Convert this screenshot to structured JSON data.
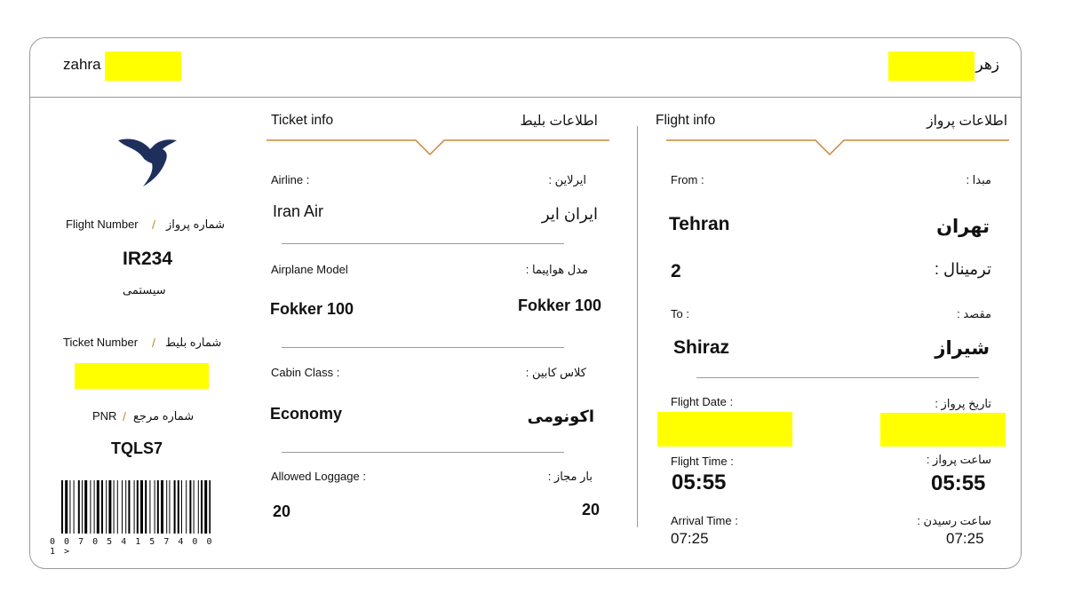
{
  "passenger": {
    "name_en": "zahra",
    "name_fa": "زهرا"
  },
  "stub": {
    "flight_number_label_en": "Flight Number",
    "flight_number_label_fa": "شماره پرواز",
    "separator": "/",
    "flight_number": "IR234",
    "flight_type_fa": "سیستمی",
    "ticket_number_label_en": "Ticket Number",
    "ticket_number_label_fa": "شماره بلیط",
    "pnr_label_en": "PNR",
    "pnr_label_fa": "شماره مرجع",
    "pnr": "TQLS7",
    "barcode_digits": "0 0 7 0 5 4 1 5 7 4 0 0 1 >"
  },
  "ticket_info": {
    "title_en": "Ticket info",
    "title_fa": "اطلاعات بلیط",
    "airline_label_en": "Airline :",
    "airline_label_fa": "ایرلاین :",
    "airline_en": "Iran Air",
    "airline_fa": "ایران ایر",
    "model_label_en": "Airplane Model",
    "model_label_fa": "مدل هواپیما :",
    "model_en": "Fokker 100",
    "model_fa": "Fokker 100",
    "cabin_label_en": "Cabin Class :",
    "cabin_label_fa": "کلاس کابین :",
    "cabin_en": "Economy",
    "cabin_fa": "اکونومی",
    "luggage_label_en": "Allowed Loggage :",
    "luggage_label_fa": "بار مجاز :",
    "luggage_en": "20",
    "luggage_fa": "20"
  },
  "flight_info": {
    "title_en": "Flight info",
    "title_fa": "اطلاعات پرواز",
    "from_label_en": "From :",
    "from_label_fa": "مبدا :",
    "from_en": "Tehran",
    "from_fa": "تهران",
    "terminal_label_fa": "ترمینال :",
    "terminal": "2",
    "to_label_en": "To :",
    "to_label_fa": "مقصد :",
    "to_en": "Shiraz",
    "to_fa": "شیراز",
    "date_label_en": "Flight Date :",
    "date_label_fa": "تاریخ پرواز :",
    "time_label_en": "Flight Time :",
    "time_label_fa": "ساعت پرواز :",
    "time_en": "05:55",
    "time_fa": "05:55",
    "arrival_label_en": "Arrival Time :",
    "arrival_label_fa": "ساعت رسیدن :",
    "arrival_en": "07:25",
    "arrival_fa": "07:25"
  },
  "colors": {
    "accent": "#c8873a",
    "redaction": "#ffff00",
    "logo": "#1f2f5c",
    "border": "#9a9a9a"
  },
  "icons": {
    "logo": "iran-air-homa-logo-icon"
  }
}
